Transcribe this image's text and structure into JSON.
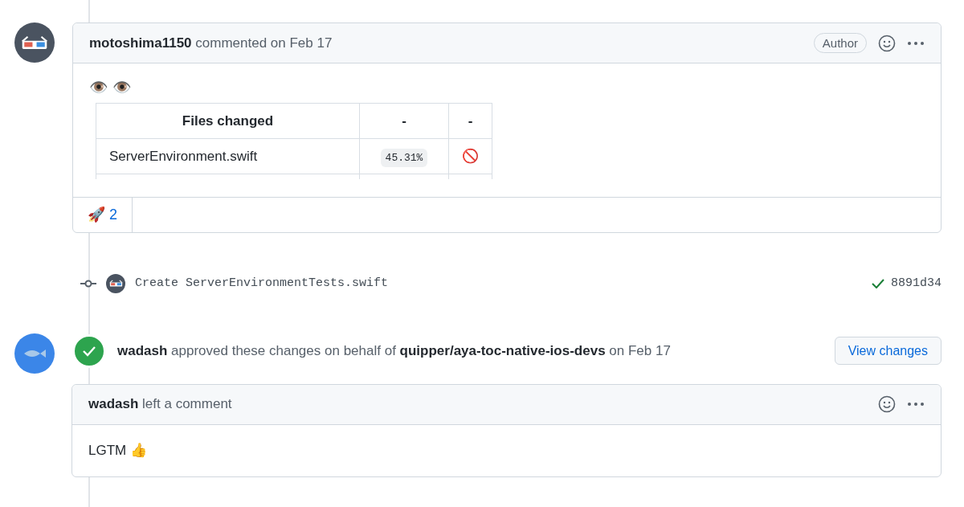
{
  "timeline": [
    {
      "kind": "comment",
      "header": "**motoshima1150** commented on Feb 17",
      "badge": "Author",
      "body_emoji": "👁️ 👁️",
      "table": {
        "columns": [
          "Files changed",
          "-",
          "-"
        ],
        "rows": [
          [
            "ServerEnvironment.swift",
            "45.31%",
            "🚫"
          ]
        ]
      },
      "reactions": [
        {
          "emoji": "🚀",
          "count": "2"
        }
      ]
    },
    {
      "kind": "commit",
      "message": "Create ServerEnvironmentTests.swift",
      "sha": "8891d34",
      "passed": true
    },
    {
      "kind": "review",
      "text": "**wadash** approved these changes on behalf of **quipper/aya-toc-native-ios-devs** on Feb 17",
      "button": "View changes",
      "comment": {
        "header": "**wadash** left a comment",
        "body": "LGTM 👍"
      }
    }
  ]
}
